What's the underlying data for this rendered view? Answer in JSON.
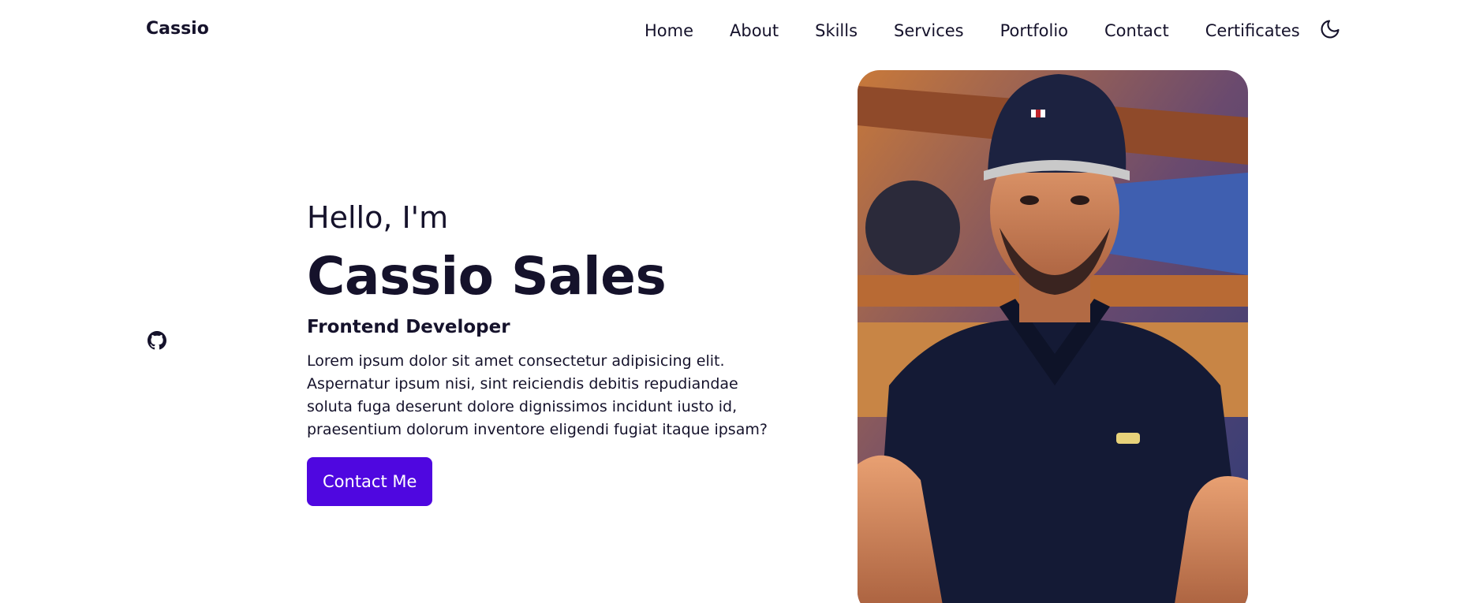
{
  "header": {
    "brand": "Cassio",
    "nav": [
      "Home",
      "About",
      "Skills",
      "Services",
      "Portfolio",
      "Contact",
      "Certificates"
    ],
    "theme_icon": "moon-icon"
  },
  "social": {
    "icon": "github-icon"
  },
  "hero": {
    "greeting": "Hello, I'm",
    "name": "Cassio Sales",
    "role": "Frontend Developer",
    "description": "Lorem ipsum dolor sit amet consectetur adipisicing elit. Aspernatur ipsum nisi, sint reiciendis debitis repudiandae soluta fuga deserunt dolore dignissimos incidunt iusto id, praesentium dolorum inventore eligendi fugiat itaque ipsam?",
    "cta_label": "Contact Me"
  },
  "colors": {
    "text": "#15122b",
    "accent": "#4f07e0",
    "background": "#ffffff"
  }
}
